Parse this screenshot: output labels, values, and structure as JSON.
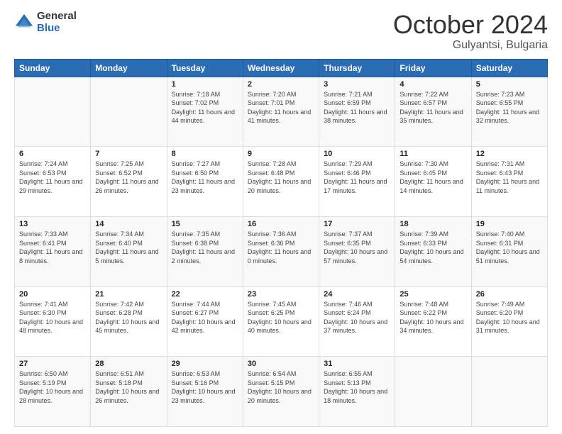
{
  "header": {
    "logo_general": "General",
    "logo_blue": "Blue",
    "month": "October 2024",
    "location": "Gulyantsi, Bulgaria"
  },
  "days_of_week": [
    "Sunday",
    "Monday",
    "Tuesday",
    "Wednesday",
    "Thursday",
    "Friday",
    "Saturday"
  ],
  "weeks": [
    [
      {
        "day": "",
        "sunrise": "",
        "sunset": "",
        "daylight": ""
      },
      {
        "day": "",
        "sunrise": "",
        "sunset": "",
        "daylight": ""
      },
      {
        "day": "1",
        "sunrise": "Sunrise: 7:18 AM",
        "sunset": "Sunset: 7:02 PM",
        "daylight": "Daylight: 11 hours and 44 minutes."
      },
      {
        "day": "2",
        "sunrise": "Sunrise: 7:20 AM",
        "sunset": "Sunset: 7:01 PM",
        "daylight": "Daylight: 11 hours and 41 minutes."
      },
      {
        "day": "3",
        "sunrise": "Sunrise: 7:21 AM",
        "sunset": "Sunset: 6:59 PM",
        "daylight": "Daylight: 11 hours and 38 minutes."
      },
      {
        "day": "4",
        "sunrise": "Sunrise: 7:22 AM",
        "sunset": "Sunset: 6:57 PM",
        "daylight": "Daylight: 11 hours and 35 minutes."
      },
      {
        "day": "5",
        "sunrise": "Sunrise: 7:23 AM",
        "sunset": "Sunset: 6:55 PM",
        "daylight": "Daylight: 11 hours and 32 minutes."
      }
    ],
    [
      {
        "day": "6",
        "sunrise": "Sunrise: 7:24 AM",
        "sunset": "Sunset: 6:53 PM",
        "daylight": "Daylight: 11 hours and 29 minutes."
      },
      {
        "day": "7",
        "sunrise": "Sunrise: 7:25 AM",
        "sunset": "Sunset: 6:52 PM",
        "daylight": "Daylight: 11 hours and 26 minutes."
      },
      {
        "day": "8",
        "sunrise": "Sunrise: 7:27 AM",
        "sunset": "Sunset: 6:50 PM",
        "daylight": "Daylight: 11 hours and 23 minutes."
      },
      {
        "day": "9",
        "sunrise": "Sunrise: 7:28 AM",
        "sunset": "Sunset: 6:48 PM",
        "daylight": "Daylight: 11 hours and 20 minutes."
      },
      {
        "day": "10",
        "sunrise": "Sunrise: 7:29 AM",
        "sunset": "Sunset: 6:46 PM",
        "daylight": "Daylight: 11 hours and 17 minutes."
      },
      {
        "day": "11",
        "sunrise": "Sunrise: 7:30 AM",
        "sunset": "Sunset: 6:45 PM",
        "daylight": "Daylight: 11 hours and 14 minutes."
      },
      {
        "day": "12",
        "sunrise": "Sunrise: 7:31 AM",
        "sunset": "Sunset: 6:43 PM",
        "daylight": "Daylight: 11 hours and 11 minutes."
      }
    ],
    [
      {
        "day": "13",
        "sunrise": "Sunrise: 7:33 AM",
        "sunset": "Sunset: 6:41 PM",
        "daylight": "Daylight: 11 hours and 8 minutes."
      },
      {
        "day": "14",
        "sunrise": "Sunrise: 7:34 AM",
        "sunset": "Sunset: 6:40 PM",
        "daylight": "Daylight: 11 hours and 5 minutes."
      },
      {
        "day": "15",
        "sunrise": "Sunrise: 7:35 AM",
        "sunset": "Sunset: 6:38 PM",
        "daylight": "Daylight: 11 hours and 2 minutes."
      },
      {
        "day": "16",
        "sunrise": "Sunrise: 7:36 AM",
        "sunset": "Sunset: 6:36 PM",
        "daylight": "Daylight: 11 hours and 0 minutes."
      },
      {
        "day": "17",
        "sunrise": "Sunrise: 7:37 AM",
        "sunset": "Sunset: 6:35 PM",
        "daylight": "Daylight: 10 hours and 57 minutes."
      },
      {
        "day": "18",
        "sunrise": "Sunrise: 7:39 AM",
        "sunset": "Sunset: 6:33 PM",
        "daylight": "Daylight: 10 hours and 54 minutes."
      },
      {
        "day": "19",
        "sunrise": "Sunrise: 7:40 AM",
        "sunset": "Sunset: 6:31 PM",
        "daylight": "Daylight: 10 hours and 51 minutes."
      }
    ],
    [
      {
        "day": "20",
        "sunrise": "Sunrise: 7:41 AM",
        "sunset": "Sunset: 6:30 PM",
        "daylight": "Daylight: 10 hours and 48 minutes."
      },
      {
        "day": "21",
        "sunrise": "Sunrise: 7:42 AM",
        "sunset": "Sunset: 6:28 PM",
        "daylight": "Daylight: 10 hours and 45 minutes."
      },
      {
        "day": "22",
        "sunrise": "Sunrise: 7:44 AM",
        "sunset": "Sunset: 6:27 PM",
        "daylight": "Daylight: 10 hours and 42 minutes."
      },
      {
        "day": "23",
        "sunrise": "Sunrise: 7:45 AM",
        "sunset": "Sunset: 6:25 PM",
        "daylight": "Daylight: 10 hours and 40 minutes."
      },
      {
        "day": "24",
        "sunrise": "Sunrise: 7:46 AM",
        "sunset": "Sunset: 6:24 PM",
        "daylight": "Daylight: 10 hours and 37 minutes."
      },
      {
        "day": "25",
        "sunrise": "Sunrise: 7:48 AM",
        "sunset": "Sunset: 6:22 PM",
        "daylight": "Daylight: 10 hours and 34 minutes."
      },
      {
        "day": "26",
        "sunrise": "Sunrise: 7:49 AM",
        "sunset": "Sunset: 6:20 PM",
        "daylight": "Daylight: 10 hours and 31 minutes."
      }
    ],
    [
      {
        "day": "27",
        "sunrise": "Sunrise: 6:50 AM",
        "sunset": "Sunset: 5:19 PM",
        "daylight": "Daylight: 10 hours and 28 minutes."
      },
      {
        "day": "28",
        "sunrise": "Sunrise: 6:51 AM",
        "sunset": "Sunset: 5:18 PM",
        "daylight": "Daylight: 10 hours and 26 minutes."
      },
      {
        "day": "29",
        "sunrise": "Sunrise: 6:53 AM",
        "sunset": "Sunset: 5:16 PM",
        "daylight": "Daylight: 10 hours and 23 minutes."
      },
      {
        "day": "30",
        "sunrise": "Sunrise: 6:54 AM",
        "sunset": "Sunset: 5:15 PM",
        "daylight": "Daylight: 10 hours and 20 minutes."
      },
      {
        "day": "31",
        "sunrise": "Sunrise: 6:55 AM",
        "sunset": "Sunset: 5:13 PM",
        "daylight": "Daylight: 10 hours and 18 minutes."
      },
      {
        "day": "",
        "sunrise": "",
        "sunset": "",
        "daylight": ""
      },
      {
        "day": "",
        "sunrise": "",
        "sunset": "",
        "daylight": ""
      }
    ]
  ]
}
